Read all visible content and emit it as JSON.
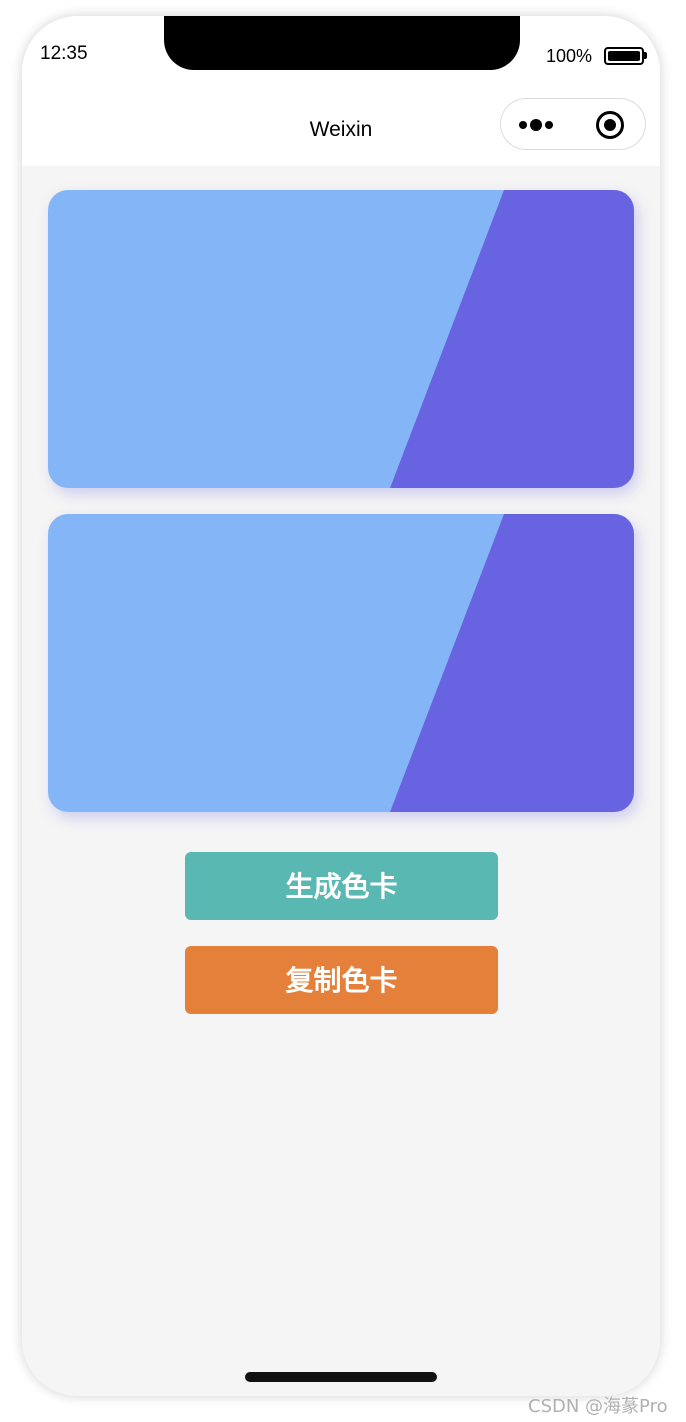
{
  "status_bar": {
    "time": "12:35",
    "battery": "100%"
  },
  "nav": {
    "title": "Weixin",
    "more_icon": "more-dots-icon",
    "close_icon": "target-close-icon"
  },
  "cards": [
    {
      "primary_color": "#84b6f7",
      "accent_color": "#6864e1"
    },
    {
      "primary_color": "#84b6f7",
      "accent_color": "#6864e1"
    }
  ],
  "buttons": {
    "generate_label": "生成色卡",
    "generate_color": "#5ab8b3",
    "copy_label": "复制色卡",
    "copy_color": "#e5803a"
  },
  "watermark": "CSDN @海蒃Pro"
}
